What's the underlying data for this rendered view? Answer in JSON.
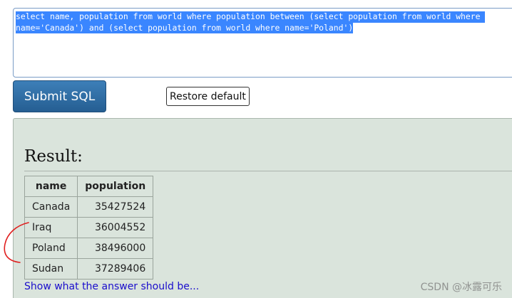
{
  "editor": {
    "sql_line1": "select name, population from world where population between (select population from world where ",
    "sql_line2": "name='Canada') and (select population from world where name='Poland')"
  },
  "buttons": {
    "submit_label": "Submit SQL",
    "restore_label": "Restore default"
  },
  "result": {
    "title": "Result:",
    "columns": [
      "name",
      "population"
    ],
    "rows": [
      {
        "name": "Canada",
        "population": "35427524"
      },
      {
        "name": "Iraq",
        "population": "36004552"
      },
      {
        "name": "Poland",
        "population": "38496000"
      },
      {
        "name": "Sudan",
        "population": "37289406"
      }
    ],
    "show_answer_link": "Show what the answer should be..."
  },
  "watermark": "CSDN @冰露可乐",
  "colors": {
    "selection": "#3a86ff",
    "submit_button": "#2f6fa8",
    "result_panel": "#dae4dc",
    "link": "#1a0dcc",
    "annotation": "#e02020"
  }
}
